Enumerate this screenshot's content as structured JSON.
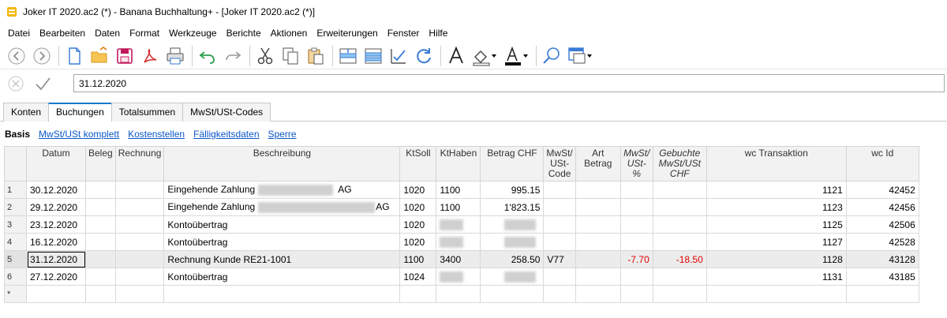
{
  "window": {
    "title": "Joker IT 2020.ac2 (*) - Banana Buchhaltung+ - [Joker IT 2020.ac2 (*)]"
  },
  "menu": [
    "Datei",
    "Bearbeiten",
    "Daten",
    "Format",
    "Werkzeuge",
    "Berichte",
    "Aktionen",
    "Erweiterungen",
    "Fenster",
    "Hilfe"
  ],
  "toolbar_icons": [
    "back-icon",
    "forward-icon",
    "new-file-icon",
    "open-folder-icon",
    "save-icon",
    "pdf-icon",
    "print-icon",
    "undo-icon",
    "redo-icon",
    "cut-icon",
    "copy-icon",
    "paste-icon",
    "insert-row-icon",
    "insert-rows-icon",
    "checklist-icon",
    "refresh-icon",
    "font-icon",
    "fill-color-icon",
    "text-color-icon",
    "search-icon",
    "window-icon"
  ],
  "entry": {
    "value": "31.12.2020"
  },
  "tabs": [
    "Konten",
    "Buchungen",
    "Totalsummen",
    "MwSt/USt-Codes"
  ],
  "active_tab": "Buchungen",
  "views": [
    "Basis",
    "MwSt/USt komplett",
    "Kostenstellen",
    "Fälligkeitsdaten",
    "Sperre"
  ],
  "active_view": "Basis",
  "columns": [
    "Datum",
    "Beleg",
    "Rechnung",
    "Beschreibung",
    "KtSoll",
    "KtHaben",
    "Betrag CHF",
    "MwSt/ USt-Code",
    "Art Betrag",
    "MwSt/ USt-%",
    "Gebuchte MwSt/USt CHF",
    "wc Transaktion",
    "wc Id"
  ],
  "rows": [
    {
      "nr": "1",
      "datum": "30.12.2020",
      "beleg": "",
      "rechnung": "",
      "beschreibung": "Eingehende Zahlung",
      "beschreibung_suffix": "AG",
      "ktsoll": "1020",
      "kthaben": "1100",
      "betrag": "995.15",
      "mwst_code": "",
      "art_betrag": "",
      "mwst_pct": "",
      "gebuchte": "",
      "wc_transaktion": "1121",
      "wc_id": "42452"
    },
    {
      "nr": "2",
      "datum": "29.12.2020",
      "beleg": "",
      "rechnung": "",
      "beschreibung": "Eingehende Zahlung",
      "beschreibung_suffix": "AG",
      "ktsoll": "1020",
      "kthaben": "1100",
      "betrag": "1'823.15",
      "mwst_code": "",
      "art_betrag": "",
      "mwst_pct": "",
      "gebuchte": "",
      "wc_transaktion": "1123",
      "wc_id": "42456"
    },
    {
      "nr": "3",
      "datum": "23.12.2020",
      "beleg": "",
      "rechnung": "",
      "beschreibung": "Kontoübertrag",
      "beschreibung_suffix": "",
      "ktsoll": "1020",
      "kthaben": "",
      "betrag": "",
      "mwst_code": "",
      "art_betrag": "",
      "mwst_pct": "",
      "gebuchte": "",
      "wc_transaktion": "1125",
      "wc_id": "42506"
    },
    {
      "nr": "4",
      "datum": "16.12.2020",
      "beleg": "",
      "rechnung": "",
      "beschreibung": "Kontoübertrag",
      "beschreibung_suffix": "",
      "ktsoll": "1020",
      "kthaben": "",
      "betrag": "",
      "mwst_code": "",
      "art_betrag": "",
      "mwst_pct": "",
      "gebuchte": "",
      "wc_transaktion": "1127",
      "wc_id": "42528"
    },
    {
      "nr": "5",
      "datum": "31.12.2020",
      "beleg": "",
      "rechnung": "",
      "beschreibung": "Rechnung Kunde RE21-1001",
      "beschreibung_suffix": "",
      "ktsoll": "1100",
      "kthaben": "3400",
      "betrag": "258.50",
      "mwst_code": "V77",
      "art_betrag": "",
      "mwst_pct": "-7.70",
      "gebuchte": "-18.50",
      "wc_transaktion": "1128",
      "wc_id": "43128"
    },
    {
      "nr": "6",
      "datum": "27.12.2020",
      "beleg": "",
      "rechnung": "",
      "beschreibung": "Kontoübertrag",
      "beschreibung_suffix": "",
      "ktsoll": "1024",
      "kthaben": "",
      "betrag": "",
      "mwst_code": "",
      "art_betrag": "",
      "mwst_pct": "",
      "gebuchte": "",
      "wc_transaktion": "1131",
      "wc_id": "43185"
    },
    {
      "nr": "*",
      "datum": "",
      "beleg": "",
      "rechnung": "",
      "beschreibung": "",
      "beschreibung_suffix": "",
      "ktsoll": "",
      "kthaben": "",
      "betrag": "",
      "mwst_code": "",
      "art_betrag": "",
      "mwst_pct": "",
      "gebuchte": "",
      "wc_transaktion": "",
      "wc_id": ""
    }
  ],
  "colors": {
    "accent": "#1979ca",
    "link": "#0b57c9",
    "negative": "#e00000",
    "app_icon": "#f2b705"
  }
}
